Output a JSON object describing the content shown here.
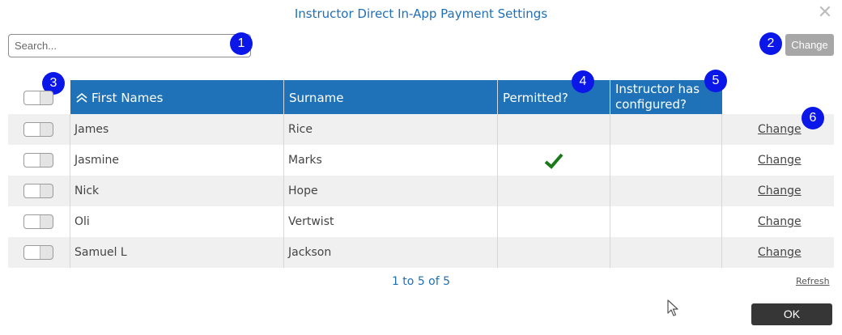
{
  "title": "Instructor Direct In-App Payment Settings",
  "search": {
    "placeholder": "Search...",
    "value": ""
  },
  "header_button": "Change",
  "badges": [
    "1",
    "2",
    "3",
    "4",
    "5",
    "6"
  ],
  "columns": {
    "first_names": "First Names",
    "surname": "Surname",
    "permitted": "Permitted?",
    "configured_line1": "Instructor has",
    "configured_line2": "configured?"
  },
  "rows": [
    {
      "first": "James",
      "surname": "Rice",
      "permitted": false,
      "action": "Change"
    },
    {
      "first": "Jasmine",
      "surname": "Marks",
      "permitted": true,
      "action": "Change"
    },
    {
      "first": "Nick",
      "surname": "Hope",
      "permitted": false,
      "action": "Change"
    },
    {
      "first": "Oli",
      "surname": "Vertwist",
      "permitted": false,
      "action": "Change"
    },
    {
      "first": "Samuel L",
      "surname": "Jackson",
      "permitted": false,
      "action": "Change"
    }
  ],
  "pagination": "1 to 5 of 5",
  "refresh": "Refresh",
  "ok": "OK",
  "icons": {
    "close": "close-icon",
    "sort": "chevron-up-icon",
    "check": "checkmark-icon",
    "cursor": "mouse-cursor-icon"
  },
  "colors": {
    "header_blue": "#1f72b8",
    "title_blue": "#1f6fb5",
    "badge_blue": "#0a17e8",
    "check_green": "#1a7a1a"
  }
}
